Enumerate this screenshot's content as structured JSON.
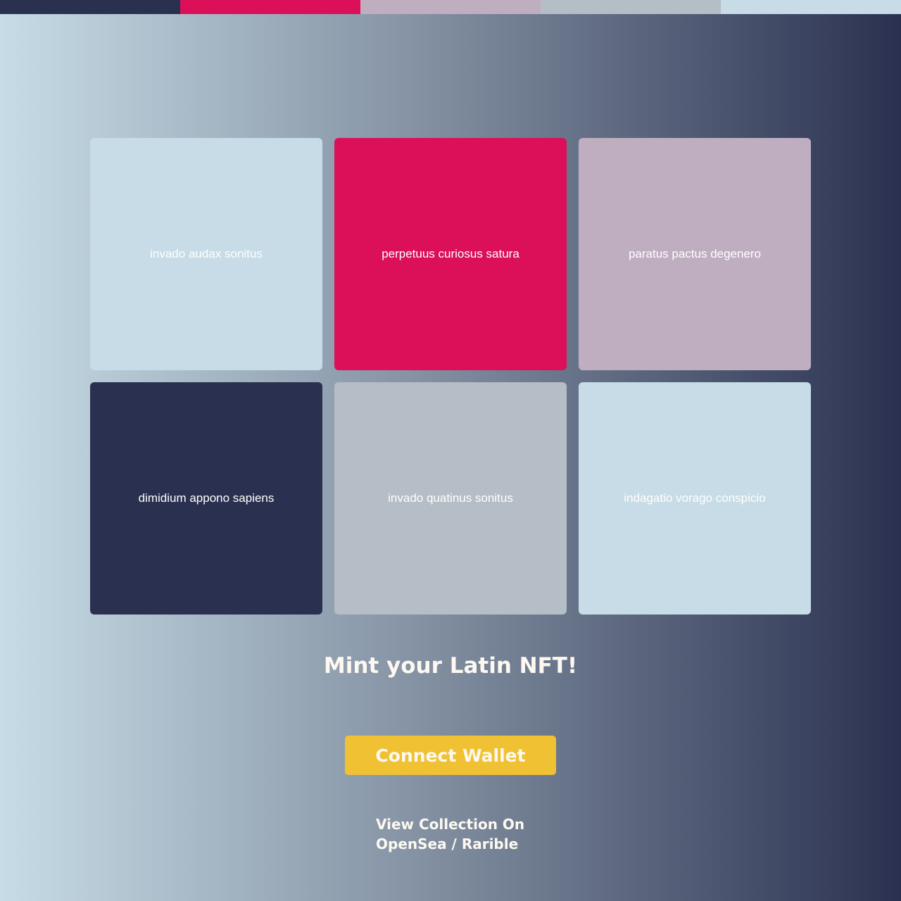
{
  "palette": {
    "navy": "#2a3150",
    "crimson": "#db1058",
    "mauve": "#bfaec0",
    "slate": "#b5bdc7",
    "pale_blue": "#c7dce6",
    "button_yellow": "#f0c132",
    "text_cream": "#fdf9f1",
    "background_gradient": [
      "#c7dce6",
      "#8694a5",
      "#2a3150"
    ]
  },
  "color_strip": [
    "#2a3150",
    "#db1058",
    "#bfaec0",
    "#b5bdc7",
    "#c7dce6"
  ],
  "cards": [
    {
      "label": "invado audax sonitus",
      "color": "#c7dce6"
    },
    {
      "label": "perpetuus curiosus satura",
      "color": "#db1058"
    },
    {
      "label": "paratus pactus degenero",
      "color": "#bfaec0"
    },
    {
      "label": "dimidium appono sapiens",
      "color": "#2a3150"
    },
    {
      "label": "invado quatinus sonitus",
      "color": "#b5bdc7"
    },
    {
      "label": "indagatio vorago conspicio",
      "color": "#c7dce6"
    }
  ],
  "mint": {
    "title": "Mint your Latin NFT!",
    "connect_label": "Connect Wallet",
    "view_link": "View Collection On OpenSea / Rarible"
  }
}
